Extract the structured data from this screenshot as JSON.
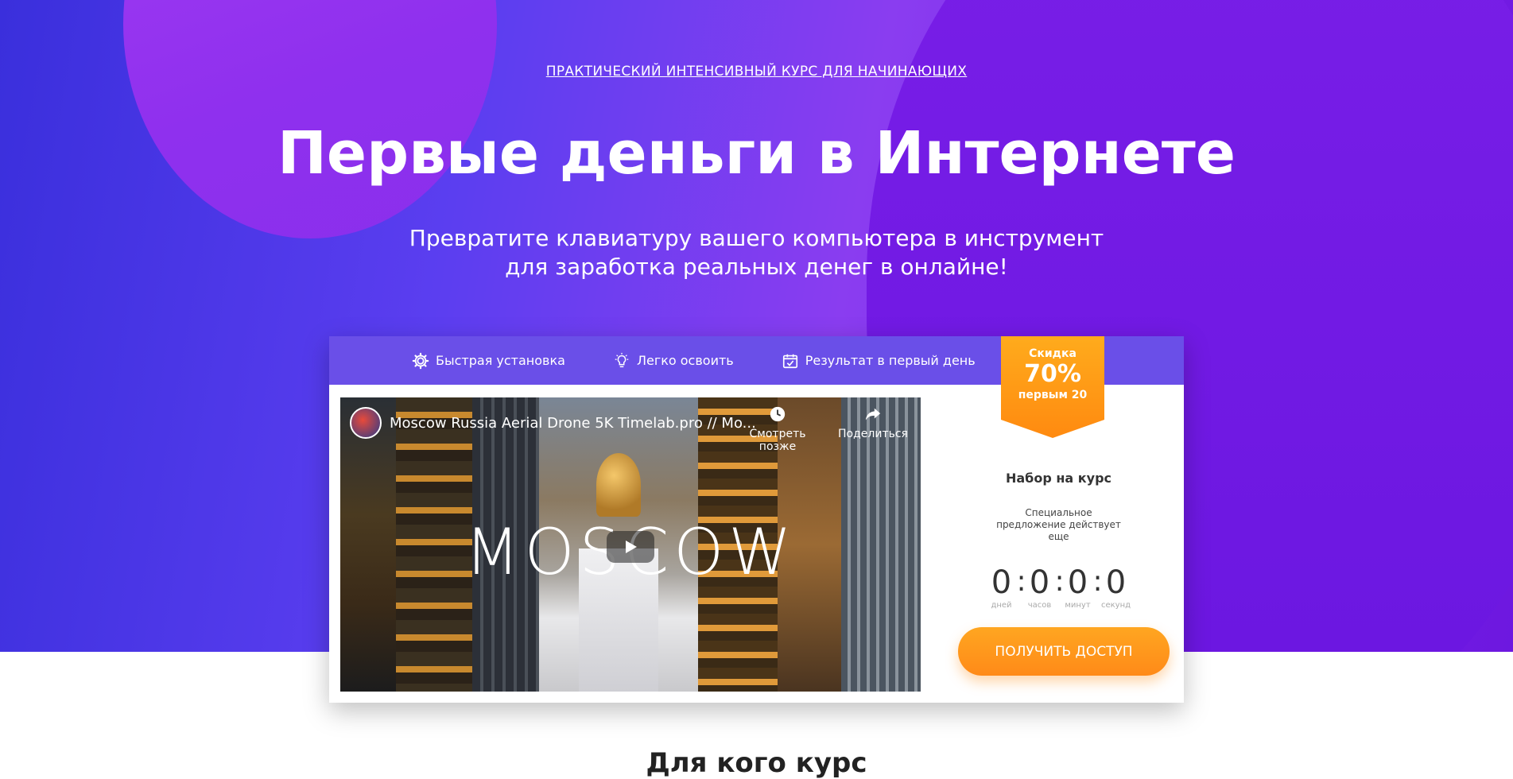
{
  "hero": {
    "eyebrow": "ПРАКТИЧЕСКИЙ ИНТЕНСИВНЫЙ КУРС ДЛЯ НАЧИНАЮЩИХ",
    "title": "Первые деньги в Интернете",
    "subtitle_line1": "Превратите клавиатуру вашего компьютера в инструмент",
    "subtitle_line2": "для заработка реальных денег в онлайне!"
  },
  "features": [
    {
      "label": "Быстрая установка",
      "icon": "gear-icon"
    },
    {
      "label": "Легко освоить",
      "icon": "lightbulb-icon"
    },
    {
      "label": "Результат в первый день",
      "icon": "calendar-check-icon"
    }
  ],
  "badge": {
    "top": "Скидка",
    "percent": "70%",
    "bottom": "первым 20"
  },
  "video": {
    "title": "Moscow Russia Aerial Drone 5K Timelab.pro // Mo...",
    "overlay_text": "MOSCOW",
    "watch_later": "Смотреть позже",
    "share": "Поделиться"
  },
  "enrollment": {
    "title": "Набор на курс",
    "note": "Специальное предложение действует еще",
    "timer": {
      "days": "0",
      "hours": "0",
      "minutes": "0",
      "seconds": "0",
      "days_label": "дней",
      "hours_label": "часов",
      "minutes_label": "минут",
      "seconds_label": "секунд"
    },
    "cta": "ПОЛУЧИТЬ ДОСТУП"
  },
  "next_section": {
    "title": "Для кого курс"
  },
  "colors": {
    "accent_orange": "#ff9a1c",
    "header_purple": "#6a4fe8"
  }
}
